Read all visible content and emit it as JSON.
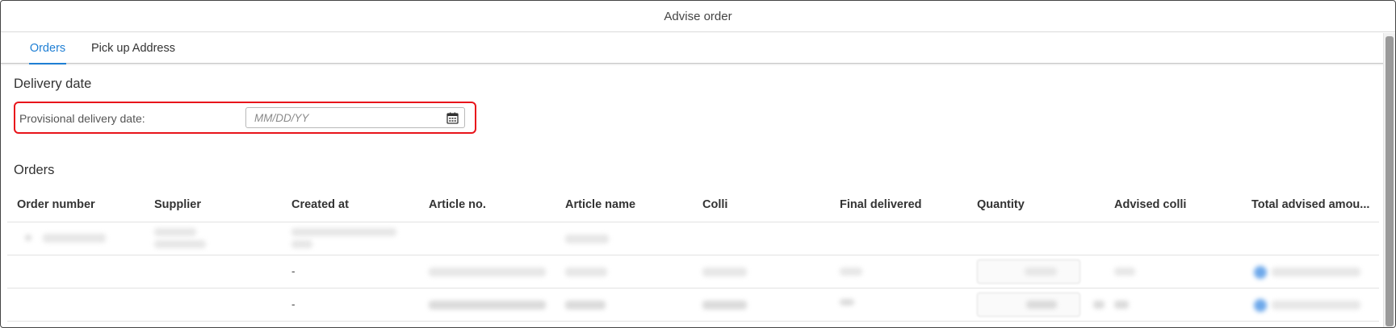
{
  "window": {
    "title": "Advise order"
  },
  "tabs": [
    {
      "label": "Orders",
      "active": true
    },
    {
      "label": "Pick up Address",
      "active": false
    }
  ],
  "delivery": {
    "section_title": "Delivery date",
    "label": "Provisional delivery date:",
    "placeholder": "MM/DD/YY",
    "icon": "calendar-icon"
  },
  "orders": {
    "section_title": "Orders",
    "columns": [
      "Order number",
      "Supplier",
      "Created at",
      "Article no.",
      "Article name",
      "Colli",
      "Final delivered",
      "Quantity",
      "Advised colli",
      "Total advised amou..."
    ],
    "rows": [
      {
        "created_at": ""
      },
      {
        "created_at": "-"
      },
      {
        "created_at": "-"
      }
    ]
  },
  "colors": {
    "accent": "#1f7fd4",
    "highlight_border": "#e8141b"
  }
}
